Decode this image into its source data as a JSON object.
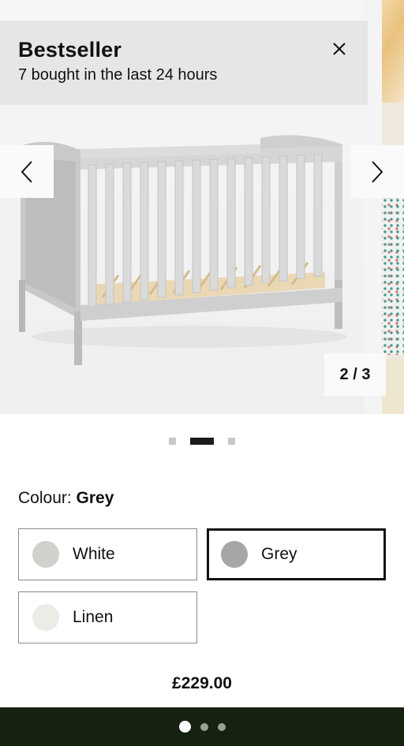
{
  "badge": {
    "title": "Bestseller",
    "subtitle": "7 bought in the last 24 hours"
  },
  "gallery": {
    "counter": "2 / 3",
    "current_index": 2,
    "total_images": 3,
    "image_alt": "Grey cot bed"
  },
  "colour": {
    "label": "Colour:",
    "selected": "Grey",
    "options": [
      {
        "name": "White",
        "swatch": "#cfd2cc",
        "selected": false
      },
      {
        "name": "Grey",
        "swatch": "#a6a6a6",
        "selected": true
      },
      {
        "name": "Linen",
        "swatch": "#ecece6",
        "selected": false
      }
    ]
  },
  "price": "£229.00",
  "footer": {
    "page_dots": 3,
    "active_dot": 1
  },
  "icons": {
    "close": "close-icon",
    "prev": "chevron-left-icon",
    "next": "chevron-right-icon"
  },
  "colors": {
    "banner_bg": "#e6e6e6",
    "footer_bg": "#14220f",
    "selected_border": "#111111"
  }
}
